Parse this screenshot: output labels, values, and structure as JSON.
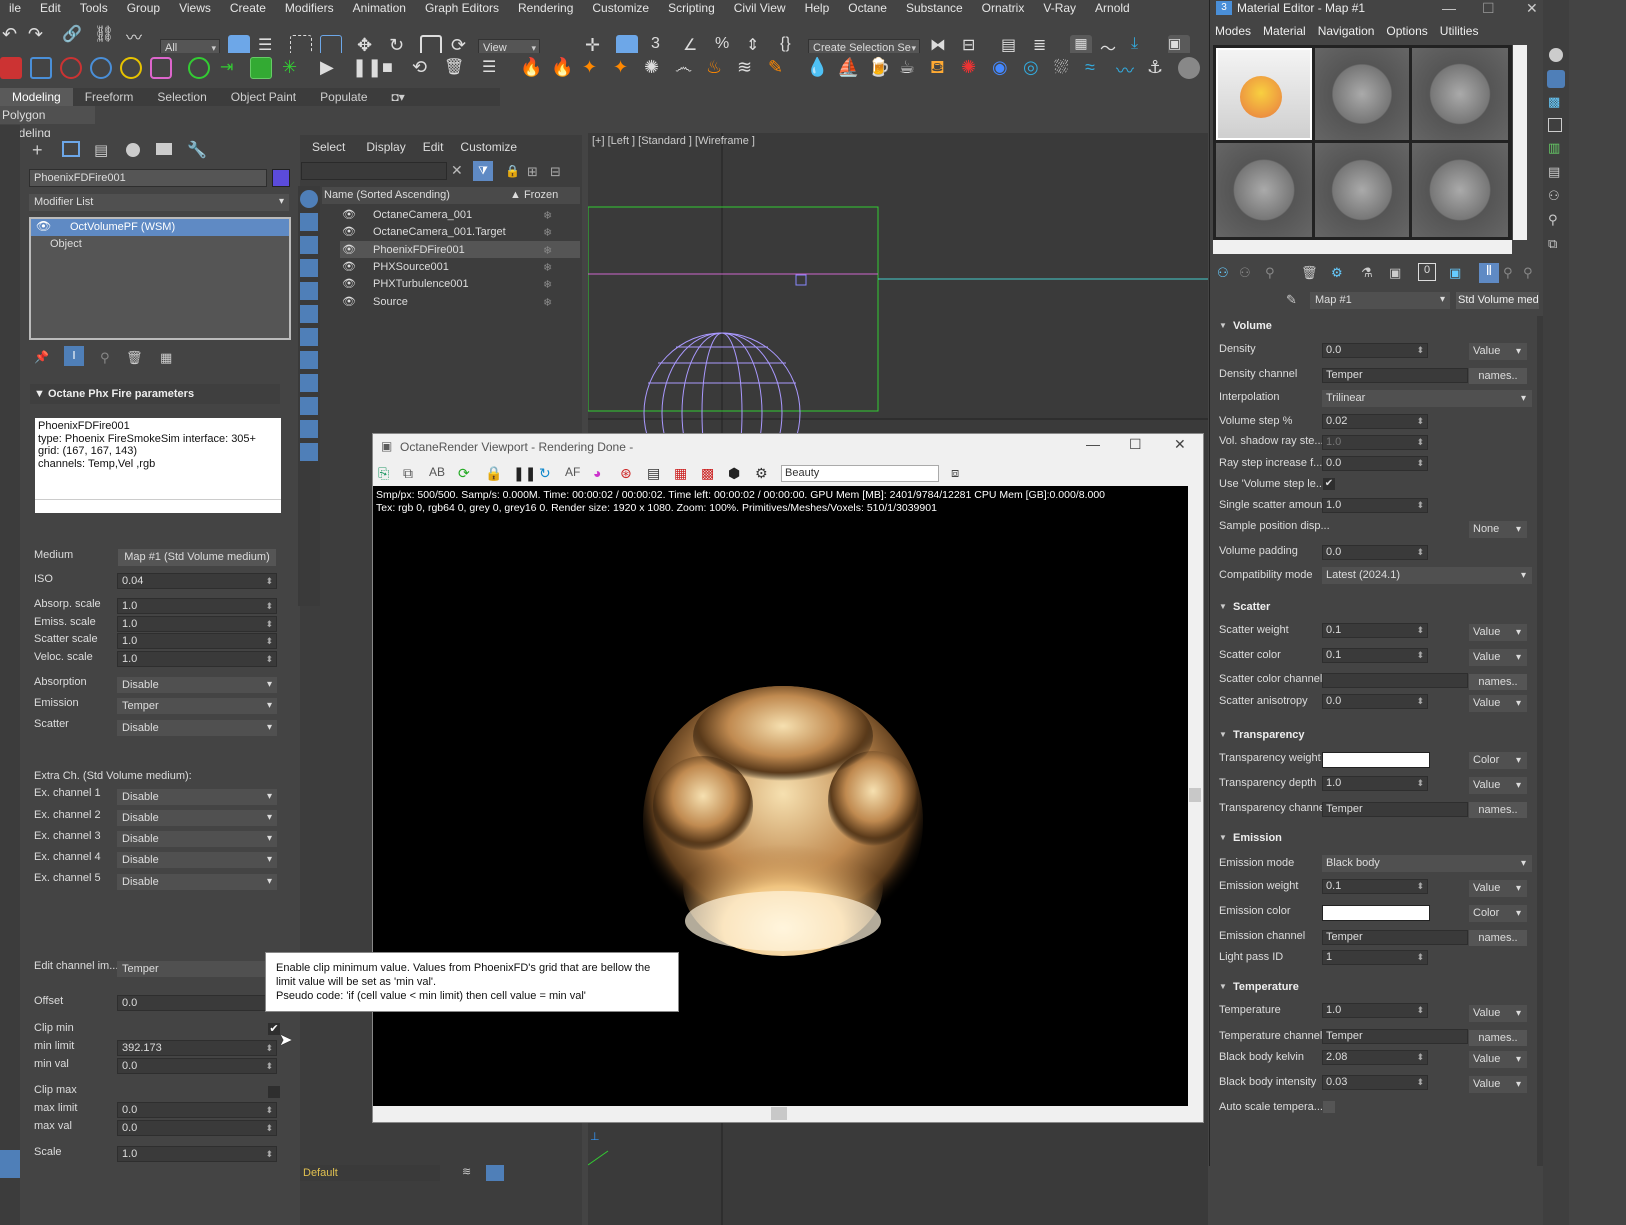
{
  "menu": [
    "ile",
    "Edit",
    "Tools",
    "Group",
    "Views",
    "Create",
    "Modifiers",
    "Animation",
    "Graph Editors",
    "Rendering",
    "Customize",
    "Scripting",
    "Civil View",
    "Help",
    "Octane",
    "Substance",
    "Ornatrix",
    "V-Ray",
    "Arnold"
  ],
  "toolbar": {
    "filter_all": "All",
    "view_mode": "View",
    "selection_set": "Create Selection Se"
  },
  "ribbon": {
    "tabs": [
      "Modeling",
      "Freeform",
      "Selection",
      "Object Paint",
      "Populate"
    ],
    "active": "Modeling",
    "sub": "Polygon Modeling"
  },
  "command_panel": {
    "object_name": "PhoenixFDFire001",
    "object_color": "#5b4bdb",
    "modifier_list": "Modifier List",
    "stack": [
      "OctVolumePF (WSM)",
      "Object"
    ],
    "rollout_title": "Octane Phx Fire parameters",
    "info_lines": [
      "PhoenixFDFire001",
      "type: Phoenix FireSmokeSim      interface: 305+",
      "grid: (167, 167, 143)",
      "channels: Temp,Vel ,rgb"
    ],
    "medium_label": "Medium",
    "medium_value": "Map #1  (Std Volume medium)",
    "iso_label": "ISO",
    "iso_value": "0.04",
    "absorp_label": "Absorp. scale",
    "absorp_value": "1.0",
    "emiss_label": "Emiss. scale",
    "emiss_value": "1.0",
    "scatter_label": "Scatter scale",
    "scatter_value": "1.0",
    "veloc_label": "Veloc. scale",
    "veloc_value": "1.0",
    "absorption_label": "Absorption",
    "absorption_value": "Disable",
    "emission_label": "Emission",
    "emission_value": "Temper",
    "scatter_ch_label": "Scatter",
    "scatter_ch_value": "Disable",
    "extra_title": "Extra Ch. (Std Volume medium):",
    "extra": [
      {
        "label": "Ex. channel 1",
        "value": "Disable"
      },
      {
        "label": "Ex. channel 2",
        "value": "Disable"
      },
      {
        "label": "Ex. channel 3",
        "value": "Disable"
      },
      {
        "label": "Ex. channel 4",
        "value": "Disable"
      },
      {
        "label": "Ex. channel 5",
        "value": "Disable"
      }
    ],
    "edit_channel_label": "Edit channel im...",
    "edit_channel_value": "Temper",
    "offset_label": "Offset",
    "offset_value": "0.0",
    "clip_min_label": "Clip min",
    "min_limit_label": "min limit",
    "min_limit_value": "392.173",
    "min_val_label": "min val",
    "min_val_value": "0.0",
    "clip_max_label": "Clip max",
    "max_limit_label": "max limit",
    "max_limit_value": "0.0",
    "max_val_label": "max val",
    "max_val_value": "0.0",
    "scale_label": "Scale",
    "scale_value": "1.0"
  },
  "tooltip": {
    "line1": "Enable clip minimum value. Values from PhoenixFD's grid that are bellow the",
    "line2": "limit value will be set as 'min val'.",
    "line3": "Pseudo code: 'if (cell value < min limit) then cell value = min val'"
  },
  "scene_explorer": {
    "menu": [
      "Select",
      "Display",
      "Edit",
      "Customize"
    ],
    "col_name": "Name (Sorted Ascending)",
    "col_frozen": "Frozen",
    "items": [
      "OctaneCamera_001",
      "OctaneCamera_001.Target",
      "PhoenixFDFire001",
      "PHXSource001",
      "PHXTurbulence001",
      "Source"
    ],
    "layer": "Default"
  },
  "viewport": {
    "label": "[+] [Left ] [Standard ] [Wireframe ]"
  },
  "octane": {
    "title": "OctaneRender Viewport - Rendering Done -",
    "pass": "Beauty",
    "stats1": "Smp/px: 500/500.   Samp/s: 0.000M.   Time: 00:00:02 / 00:00:02.   Time left: 00:00:02 / 00:00:00.   GPU Mem [MB]: 2401/9784/12281   CPU Mem [GB]:0.000/8.000",
    "stats2": "Tex: rgb 0, rgb64 0, grey 0, grey16 0.   Render size: 1920 x 1080.   Zoom: 100%.   Primitives/Meshes/Voxels: 510/1/3039901"
  },
  "material_editor": {
    "title": "Material Editor - Map #1",
    "menu": [
      "Modes",
      "Material",
      "Navigation",
      "Options",
      "Utilities"
    ],
    "map_name": "Map #1",
    "map_type": "Std Volume mediur",
    "volume": {
      "title": "Volume",
      "density_label": "Density",
      "density": "0.0",
      "density_type": "Value",
      "density_channel_label": "Density channel",
      "density_channel": "Temper",
      "names": "names..",
      "interp_label": "Interpolation",
      "interp": "Trilinear",
      "step_label": "Volume step %",
      "step": "0.02",
      "shadow_label": "Vol. shadow ray ste...",
      "shadow": "1.0",
      "ray_inc_label": "Ray step increase f...",
      "ray_inc": "0.0",
      "use_step_label": "Use 'Volume step le...",
      "single_label": "Single scatter amount",
      "single": "1.0",
      "sample_label": "Sample position disp...",
      "sample": "None",
      "padding_label": "Volume padding",
      "padding": "0.0",
      "compat_label": "Compatibility mode",
      "compat": "Latest (2024.1)"
    },
    "scatter": {
      "title": "Scatter",
      "weight_label": "Scatter weight",
      "weight": "0.1",
      "weight_type": "Value",
      "color_label": "Scatter color",
      "color": "0.1",
      "color_type": "Value",
      "channel_label": "Scatter color channel",
      "names": "names..",
      "aniso_label": "Scatter anisotropy",
      "aniso": "0.0",
      "aniso_type": "Value"
    },
    "transparency": {
      "title": "Transparency",
      "weight_label": "Transparency weight",
      "weight_type": "Color",
      "depth_label": "Transparency depth",
      "depth": "1.0",
      "depth_type": "Value",
      "channel_label": "Transparency channel",
      "channel": "Temper",
      "names": "names.."
    },
    "emission": {
      "title": "Emission",
      "mode_label": "Emission mode",
      "mode": "Black body",
      "weight_label": "Emission weight",
      "weight": "0.1",
      "weight_type": "Value",
      "color_label": "Emission color",
      "color_type": "Color",
      "channel_label": "Emission channel",
      "channel": "Temper",
      "names": "names..",
      "lightpass_label": "Light pass ID",
      "lightpass": "1"
    },
    "temperature": {
      "title": "Temperature",
      "temp_label": "Temperature",
      "temp": "1.0",
      "temp_type": "Value",
      "channel_label": "Temperature channel",
      "channel": "Temper",
      "names": "names..",
      "kelvin_label": "Black body kelvin",
      "kelvin": "2.08",
      "kelvin_type": "Value",
      "intensity_label": "Black body intensity",
      "intensity": "0.03",
      "intensity_type": "Value",
      "autoscale_label": "Auto scale tempera..."
    }
  }
}
